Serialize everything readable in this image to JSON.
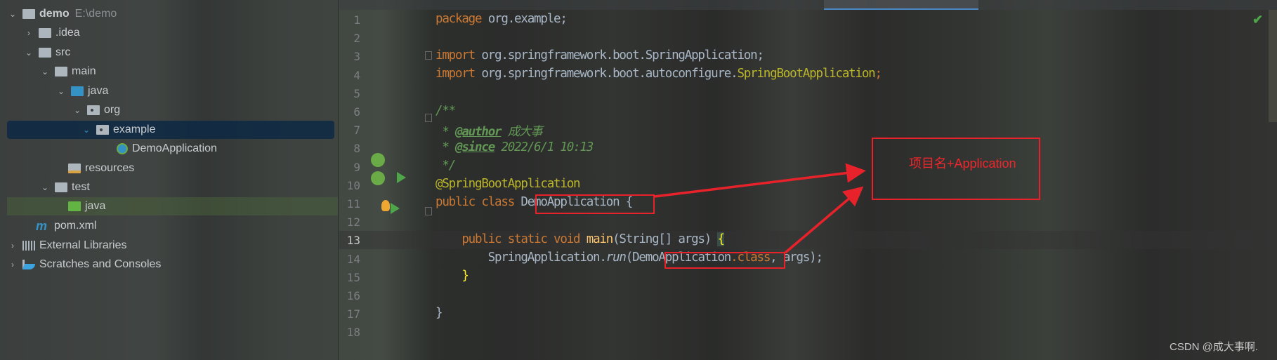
{
  "project_tree": [
    {
      "label": "demo",
      "path": "E:\\demo",
      "depth": 0,
      "expanded": true,
      "icon": "module-folder-icon"
    },
    {
      "label": ".idea",
      "depth": 1,
      "expanded": false,
      "icon": "folder-icon"
    },
    {
      "label": "src",
      "depth": 1,
      "expanded": true,
      "icon": "folder-icon"
    },
    {
      "label": "main",
      "depth": 2,
      "expanded": true,
      "icon": "folder-icon"
    },
    {
      "label": "java",
      "depth": 3,
      "expanded": true,
      "icon": "source-folder-icon"
    },
    {
      "label": "org",
      "depth": 4,
      "expanded": true,
      "icon": "package-icon"
    },
    {
      "label": "example",
      "depth": 5,
      "expanded": true,
      "icon": "package-icon",
      "selected": true
    },
    {
      "label": "DemoApplication",
      "depth": 6,
      "icon": "spring-boot-class-icon"
    },
    {
      "label": "resources",
      "depth": 3,
      "icon": "resources-folder-icon"
    },
    {
      "label": "test",
      "depth": 2,
      "expanded": true,
      "icon": "folder-icon"
    },
    {
      "label": "java",
      "depth": 3,
      "icon": "test-folder-icon",
      "highlighted": true
    },
    {
      "label": "pom.xml",
      "depth": 1,
      "icon": "maven-icon"
    },
    {
      "label": "External Libraries",
      "depth": 0,
      "expanded": false,
      "icon": "libraries-icon"
    },
    {
      "label": "Scratches and Consoles",
      "depth": 0,
      "expanded": false,
      "icon": "scratches-icon"
    }
  ],
  "editor": {
    "current_line": 13,
    "line_numbers": [
      "1",
      "2",
      "3",
      "4",
      "5",
      "6",
      "7",
      "8",
      "9",
      "10",
      "11",
      "12",
      "13",
      "14",
      "15",
      "16",
      "17",
      "18"
    ],
    "code": {
      "l1_kw": "package",
      "l1_rest": " org.example;",
      "l3_kw": "import",
      "l3_rest": " org.springframework.boot.SpringApplication;",
      "l4_kw": "import",
      "l4_pre": " org.springframework.boot.autoconfigure.",
      "l4_cls": "SpringBootApplication",
      "l4_end": ";",
      "l6": "/**",
      "l7_star": " * ",
      "l7_tag": "@author",
      "l7_val": " 成大事",
      "l8_star": " * ",
      "l8_tag": "@since",
      "l8_val": " 2022/6/1 10:13",
      "l9": " */",
      "l10": "@SpringBootApplication",
      "l11_kw": "public class ",
      "l11_cls": "DemoApplication",
      "l11_end": " {",
      "l13_kw": "    public static void ",
      "l13_fn": "main",
      "l13_args": "(String[] args) ",
      "l13_br": "{",
      "l14_a": "        SpringApplication.",
      "l14_run": "run",
      "l14_p": "(",
      "l14_cls": "DemoApplication",
      "l14_kw": ".class",
      "l14_end": ", args);",
      "l15": "    }",
      "l17": "}"
    }
  },
  "annotation": {
    "note": "项目名+Application",
    "color": "#e8222a"
  },
  "status": {
    "inspection": "no-problems-check-icon"
  },
  "watermark": "CSDN @成大事啊."
}
